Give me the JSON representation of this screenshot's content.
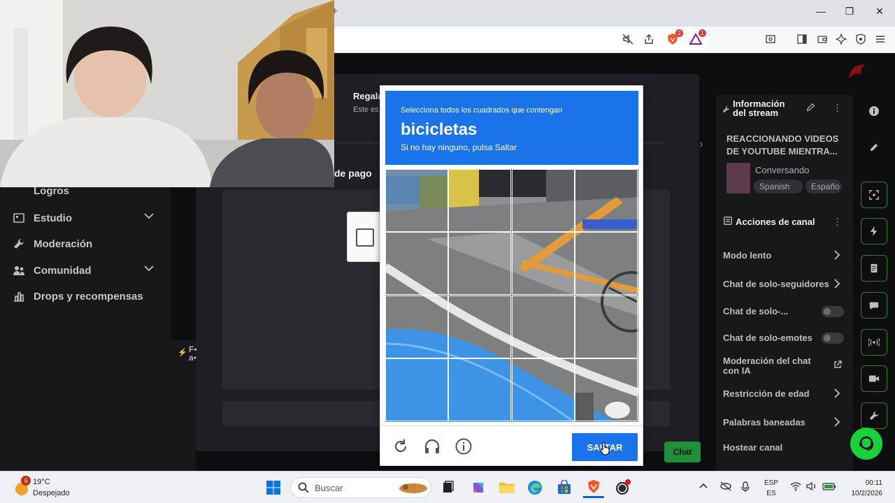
{
  "window": {
    "new_tab_symbol": "+",
    "minimize_symbol": "—",
    "maximize_symbol": "❐",
    "close_symbol": "✕"
  },
  "toolbar": {
    "brave_shields_badge": "2",
    "rewards_badge": "1",
    "icons": [
      "mute-icon",
      "share-icon",
      "brave-shields-icon",
      "brave-rewards-icon",
      "reader-mode-icon",
      "sidebar-icon",
      "wallet-icon",
      "leo-ai-icon",
      "vpn-icon",
      "menu-icon"
    ]
  },
  "left_nav": {
    "items": [
      {
        "label": "Logros"
      },
      {
        "label": "Estudio",
        "expandable": true
      },
      {
        "label": "Moderación"
      },
      {
        "label": "Comunidad",
        "expandable": true
      },
      {
        "label": "Drops y recompensas"
      }
    ]
  },
  "modal": {
    "title": "Regala",
    "subtitle": "Este es",
    "payment_label": "de pago",
    "side_label": "F• a•",
    "chat_button": "Chat"
  },
  "stream_info": {
    "heading": "Información del stream",
    "title": "REACCIONANDO VIDEOS DE YOUTUBE MIENTRA...",
    "category": "Conversando",
    "tags": [
      "Spanish",
      "Españo"
    ]
  },
  "channel_actions": {
    "heading": "Acciones de canal",
    "items": [
      {
        "label": "Modo lento",
        "control": "chevron"
      },
      {
        "label": "Chat de solo-seguidores",
        "control": "chevron"
      },
      {
        "label": "Chat de solo-...",
        "control": "toggle",
        "on": false
      },
      {
        "label": "Chat de solo-emotes",
        "control": "toggle",
        "on": false
      },
      {
        "label": "Moderación del chat con IA",
        "control": "external"
      },
      {
        "label": "Restricción de edad",
        "control": "chevron"
      },
      {
        "label": "Palabras baneadas",
        "control": "chevron"
      },
      {
        "label": "Hostear canal",
        "control": "none"
      }
    ]
  },
  "captcha": {
    "instruction": "Selecciona todos los cuadrados que contengan",
    "object": "bicicletas",
    "skip_hint": "Si no hay ninguno, pulsa Saltar",
    "skip_button": "SALTAR",
    "grid_size": 4,
    "tools": [
      "reload-icon",
      "audio-icon",
      "info-icon"
    ],
    "accent": "#1a73e8"
  },
  "taskbar": {
    "weather_alert": "6",
    "temperature": "19°C",
    "condition": "Despejado",
    "search_label": "Buscar",
    "language_line1": "ESP",
    "language_line2": "ES",
    "time": "00:11",
    "date": "10/2/2026"
  }
}
